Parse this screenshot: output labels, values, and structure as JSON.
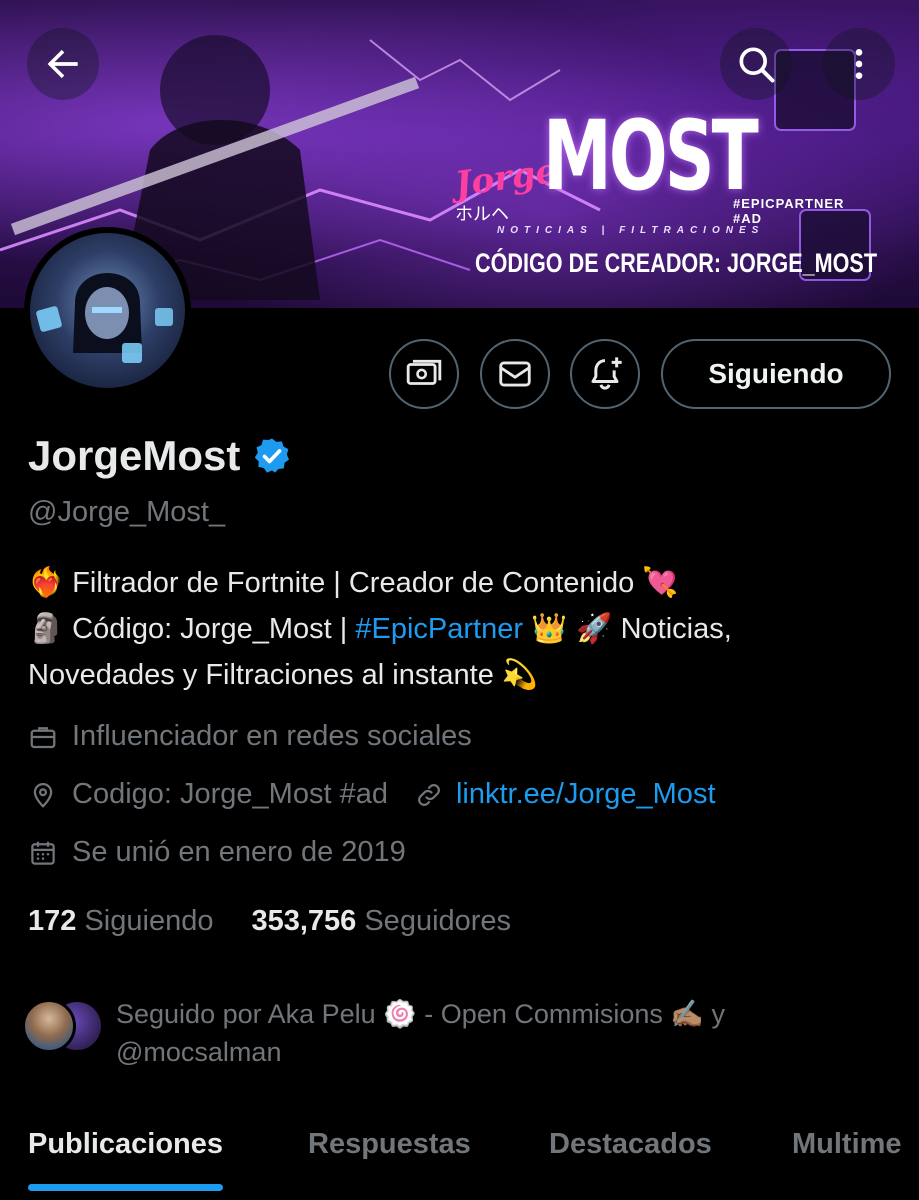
{
  "banner": {
    "script_text": "Jorge",
    "kana_text": "ホルヘ",
    "title_text": "MOST",
    "tags_text": "#EPICPARTNER #AD",
    "subtitle_text": "NOTICIAS | FILTRACIONES",
    "creator_code_text": "CÓDIGO DE CREADOR: JORGE_MOST"
  },
  "header_icons": {
    "back": "arrow-left-icon",
    "search": "search-icon",
    "more": "more-vertical-icon"
  },
  "actions": {
    "tip_icon": "money-icon",
    "message_icon": "envelope-icon",
    "notify_icon": "bell-plus-icon",
    "follow_label": "Siguiendo"
  },
  "profile": {
    "display_name": "JorgeMost",
    "handle": "@Jorge_Most_",
    "verified": true
  },
  "bio": {
    "line1_emoji_start": "❤️‍🔥",
    "line1_text": "Filtrador de Fortnite | Creador de Contenido",
    "line1_emoji_end": "💘",
    "line2_emoji_start": "🗿",
    "line2_text": "Código: Jorge_Most |",
    "hashtag": "#EpicPartner",
    "line2_emojis": "👑 🚀",
    "line2_tail": "Noticias,",
    "line3_text": "Novedades y Filtraciones al instante",
    "line3_emoji": "💫"
  },
  "meta": {
    "profession": "Influenciador en redes sociales",
    "location": "Codigo: Jorge_Most #ad",
    "website": "linktr.ee/Jorge_Most",
    "joined": "Se unió en enero de 2019"
  },
  "counts": {
    "following_number": "172",
    "following_label": "Siguiendo",
    "followers_number": "353,756",
    "followers_label": "Seguidores"
  },
  "followed_by": {
    "text_line1": "Seguido por Aka Pelu 🍥 - Open Commisions ✍🏽 y",
    "text_line2": "@mocsalman"
  },
  "tabs": [
    {
      "label": "Publicaciones",
      "active": true
    },
    {
      "label": "Respuestas",
      "active": false
    },
    {
      "label": "Destacados",
      "active": false
    },
    {
      "label": "Multime",
      "active": false
    }
  ],
  "colors": {
    "accent": "#1d9bf0",
    "muted": "#71767b",
    "text": "#e7e9ea",
    "border": "#536471",
    "background": "#000000"
  }
}
